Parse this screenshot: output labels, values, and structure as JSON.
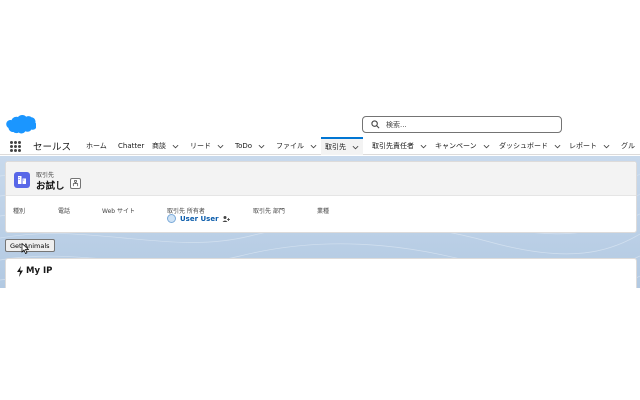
{
  "header": {
    "logo_name": "salesforce-cloud-logo",
    "search_placeholder": "検索..."
  },
  "nav": {
    "app_name": "セールス",
    "items": [
      {
        "label": "ホーム",
        "chevron": false
      },
      {
        "label": "Chatter",
        "chevron": false
      },
      {
        "label": "商談",
        "chevron": true
      },
      {
        "label": "リード",
        "chevron": true
      },
      {
        "label": "ToDo",
        "chevron": true
      },
      {
        "label": "ファイル",
        "chevron": true
      },
      {
        "label": "取引先",
        "chevron": true,
        "active": true
      },
      {
        "label": "取引先責任者",
        "chevron": true
      },
      {
        "label": "キャンペーン",
        "chevron": true
      },
      {
        "label": "ダッシュボード",
        "chevron": true
      },
      {
        "label": "レポート",
        "chevron": true
      },
      {
        "label": "グル",
        "chevron": false
      }
    ]
  },
  "record": {
    "object_type": "取引先",
    "name": "お試し",
    "icon": "account-icon",
    "fields": [
      {
        "label": "種別"
      },
      {
        "label": "電話"
      },
      {
        "label": "Web サイト"
      },
      {
        "label": "取引先 所有者"
      },
      {
        "label": "取引先 部門"
      },
      {
        "label": "業種"
      }
    ],
    "owner": "User User"
  },
  "actions": {
    "get_animals_label": "Get Animals"
  },
  "ip_card": {
    "title": "My IP",
    "icon": "lightning-icon"
  },
  "colors": {
    "brand": "#0176d3",
    "record_icon": "#5867e8",
    "link": "#0b5cab"
  }
}
